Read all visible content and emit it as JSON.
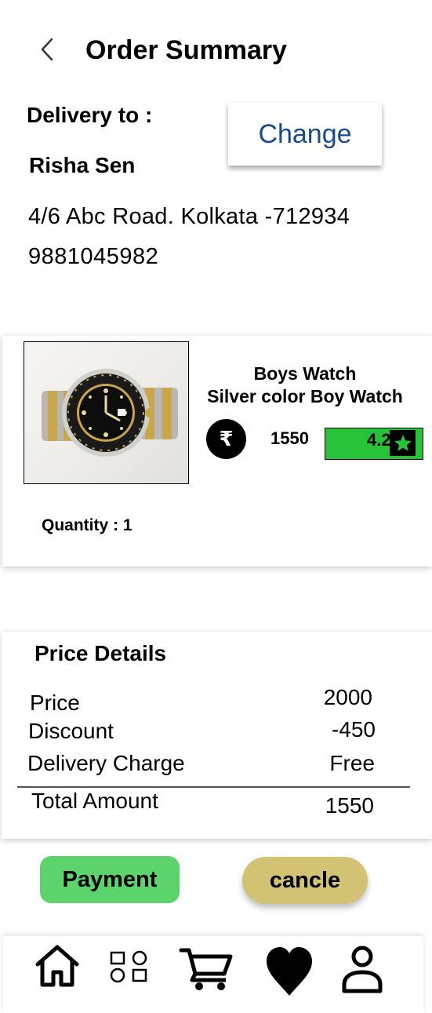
{
  "header": {
    "title": "Order Summary",
    "back_icon": "chevron-left-icon"
  },
  "delivery": {
    "label": "Delivery to :",
    "change_label": "Change",
    "name": "Risha Sen",
    "address": "4/6 Abc Road.  Kolkata -712934",
    "phone": "9881045982"
  },
  "product": {
    "title": "Boys Watch",
    "subtitle": "Silver color Boy Watch",
    "currency_icon": "rupee-icon",
    "currency_symbol": "₹",
    "price": "1550",
    "rating": "4.2",
    "rating_icon": "star-icon",
    "quantity": "Quantity : 1"
  },
  "price_details": {
    "title": "Price Details",
    "rows": [
      {
        "label": "Price",
        "value": "2000"
      },
      {
        "label": "Discount",
        "value": "-450"
      },
      {
        "label": "Delivery Charge",
        "value": "Free"
      }
    ],
    "total": {
      "label": "Total Amount",
      "value": "1550"
    }
  },
  "actions": {
    "payment_label": "Payment",
    "cancel_label": "cancle"
  },
  "nav": {
    "items": [
      "home-icon",
      "categories-icon",
      "cart-icon",
      "heart-icon",
      "profile-icon"
    ]
  },
  "colors": {
    "accent_blue": "#1a4b8e",
    "rating_green": "#27c13a",
    "payment_green": "#5cd36b",
    "cancel_khaki": "#d1c373"
  }
}
